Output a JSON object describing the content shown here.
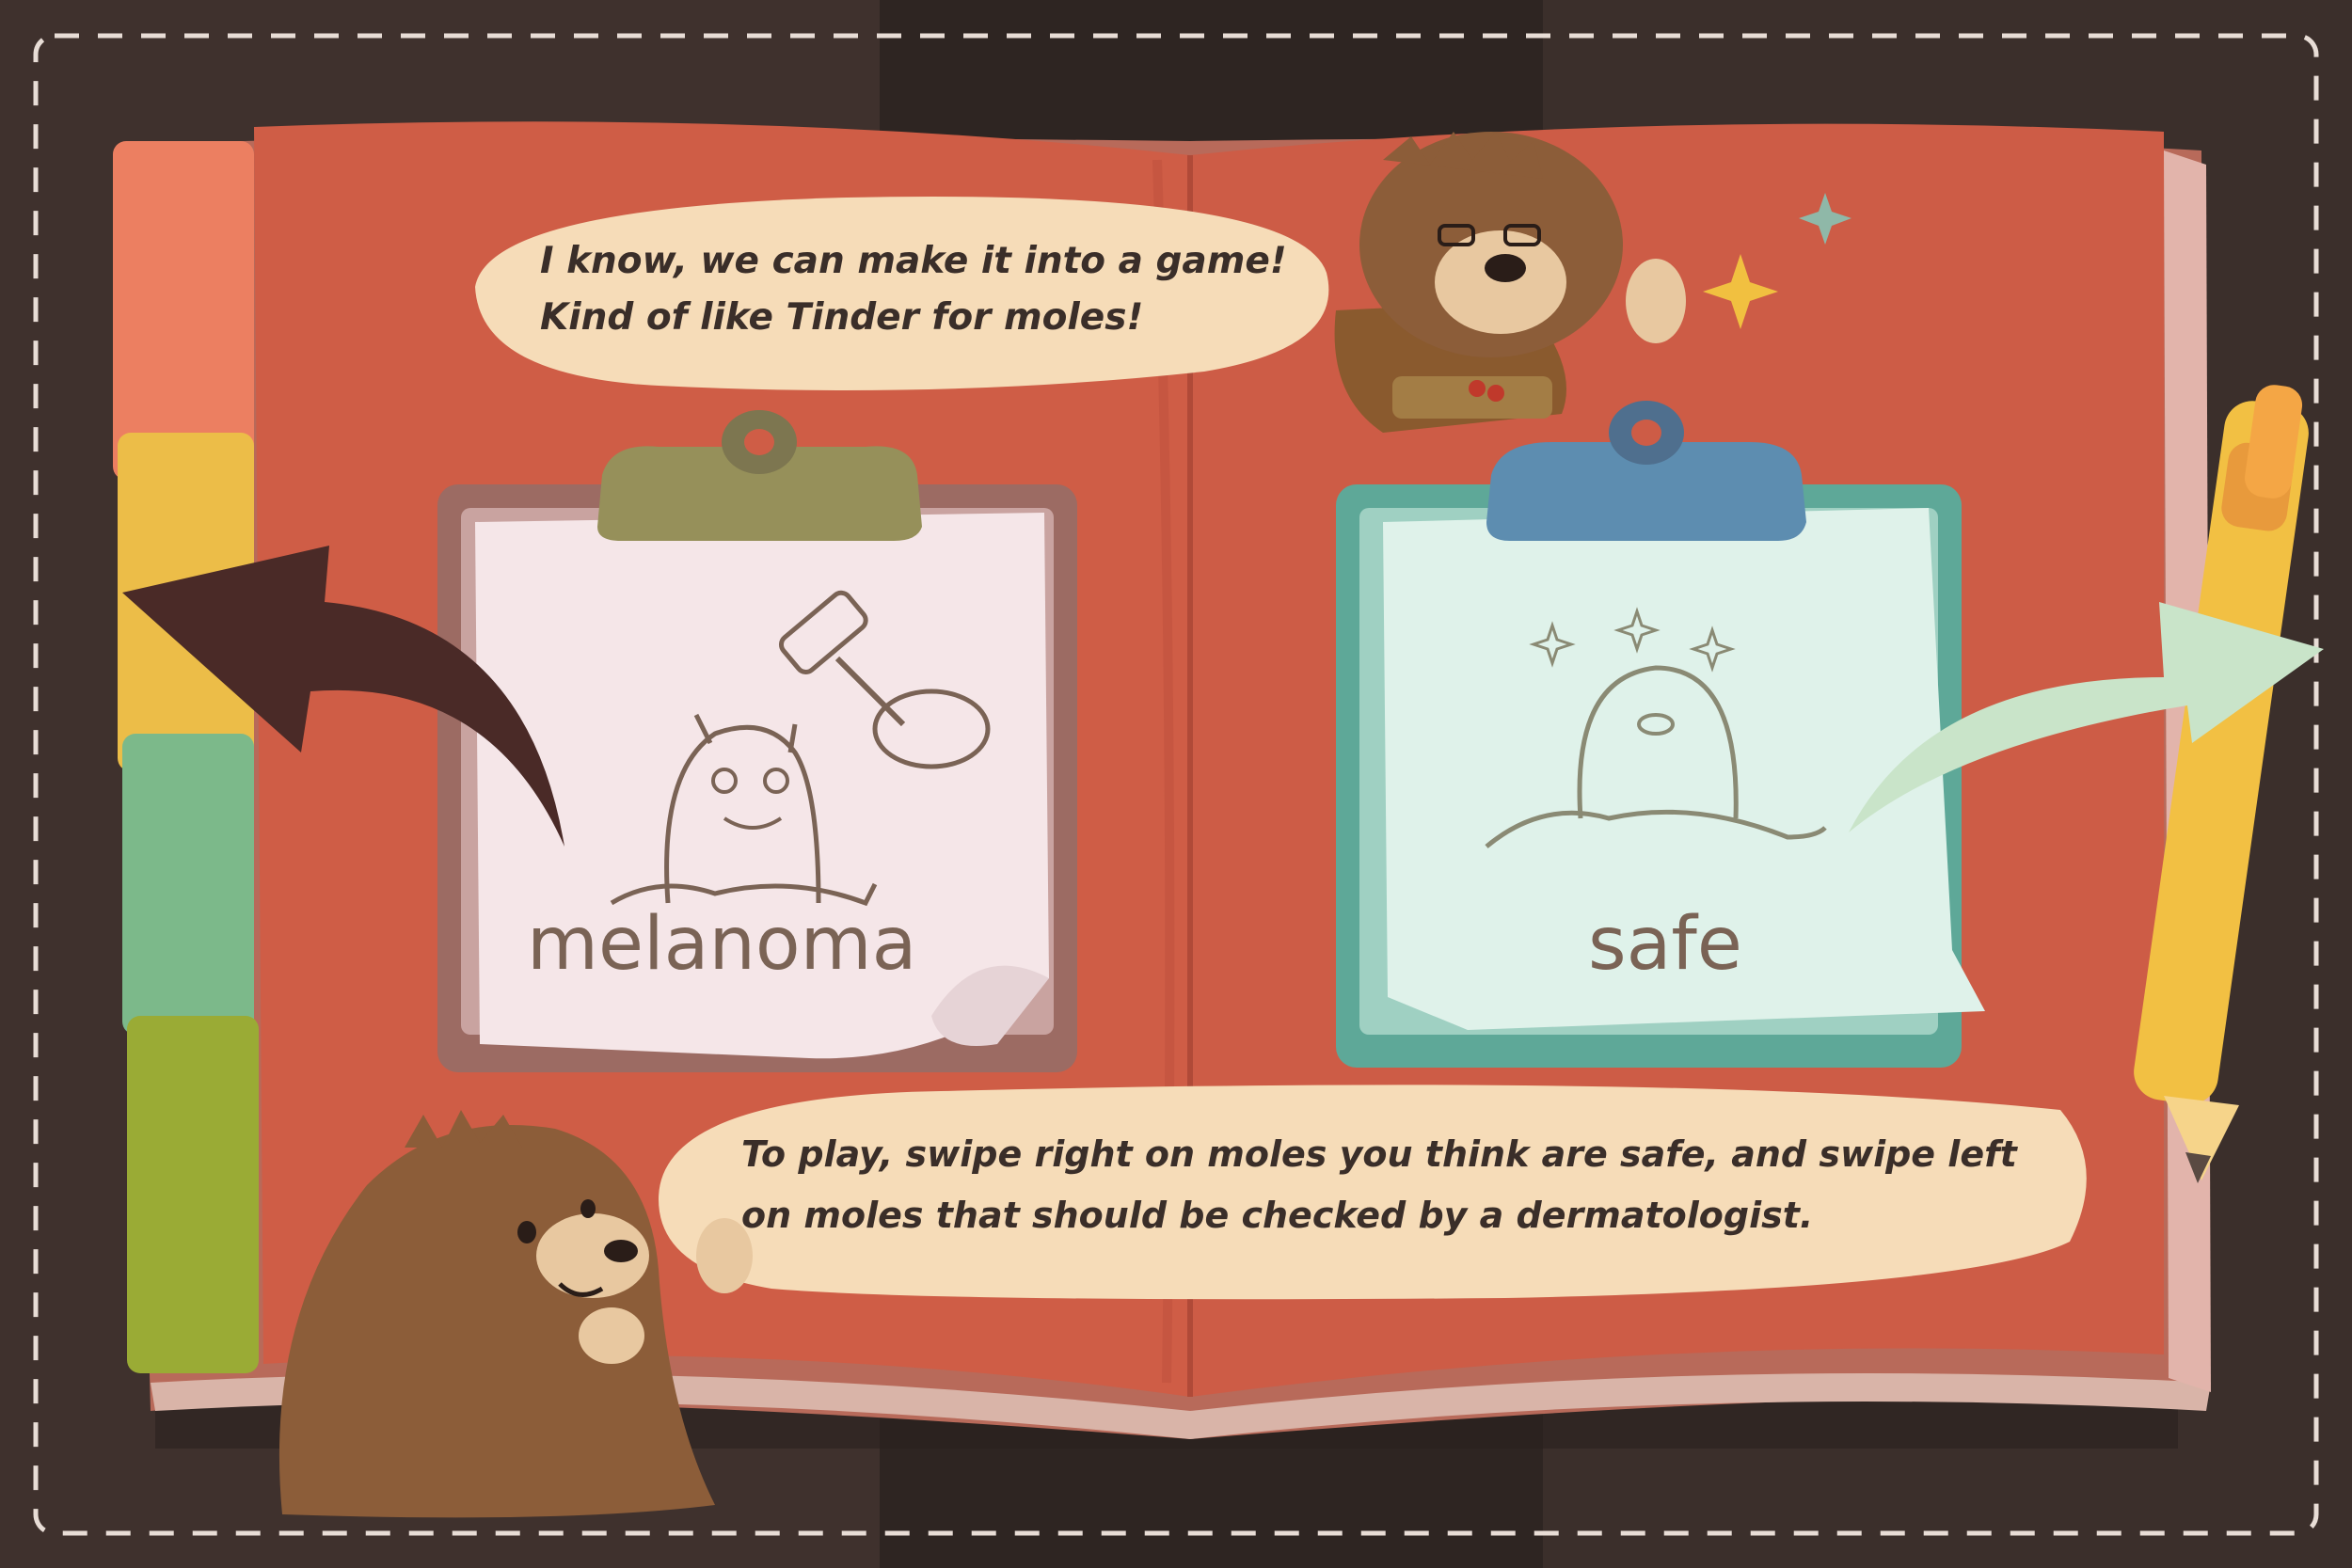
{
  "dialogue": {
    "top_line1": "I know, we can make it into a game!",
    "top_line2": "Kind of like Tinder for moles!",
    "bottom_line1": "To play, swipe right on moles you think are safe, and swipe left",
    "bottom_line2": "on moles that should be checked by a dermatologist."
  },
  "cards": {
    "left_label": "melanoma",
    "right_label": "safe"
  },
  "colors": {
    "background": "#3f312d",
    "book_page": "#cf5d46",
    "speech_bubble": "#f6dcb8",
    "left_paper": "#f5e6e8",
    "right_paper": "#dff2ea",
    "left_arrow": "#4a2a27",
    "right_arrow": "#c9e4c9"
  },
  "icons": {
    "left_arrow": "swipe-left-arrow-icon",
    "right_arrow": "swipe-right-arrow-icon",
    "pen": "pen-icon",
    "sparkle": "sparkle-icon"
  }
}
